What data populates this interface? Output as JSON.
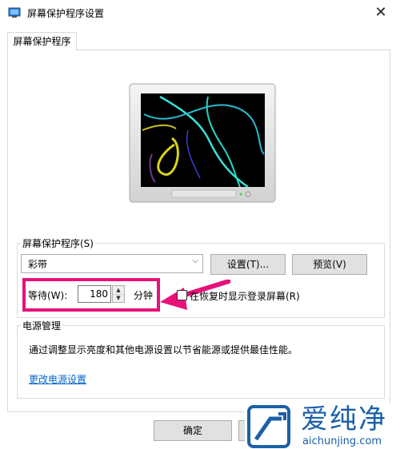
{
  "window": {
    "title": "屏幕保护程序设置",
    "close_glyph": "✕",
    "icon": "display-settings-icon"
  },
  "tab": {
    "label": "屏幕保护程序"
  },
  "screensaver": {
    "group_label": "屏幕保护程序(S)",
    "selected": "彩带",
    "settings_button": "设置(T)...",
    "preview_button": "预览(V)",
    "wait_label": "等待(W):",
    "wait_value": "180",
    "wait_unit": "分钟",
    "resume_checkbox_label": "在恢复时显示登录屏幕(R)",
    "resume_checked": false
  },
  "power": {
    "group_label": "电源管理",
    "description": "通过调整显示亮度和其他电源设置以节省能源或提供最佳性能。",
    "link": "更改电源设置"
  },
  "footer": {
    "ok_button": "确定",
    "cancel_button": ""
  },
  "annotation": {
    "highlight_color": "#e6127a"
  },
  "watermark": {
    "brand": "爱纯净",
    "url": "aichunjing.com"
  },
  "colors": {
    "link": "#0066cc",
    "brand": "#1b5fa8"
  }
}
